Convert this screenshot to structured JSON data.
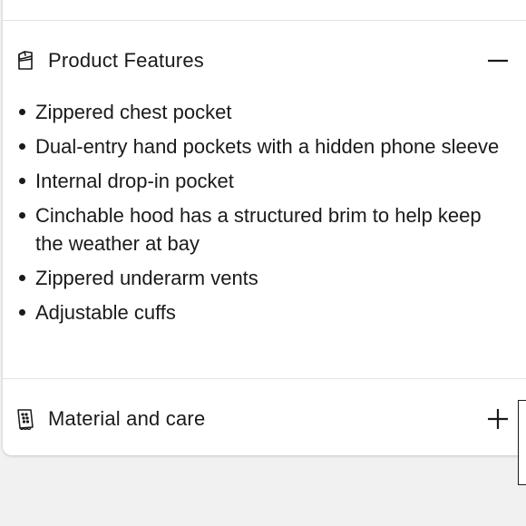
{
  "product_features": {
    "title": "Product Features",
    "icon": "jacket-icon",
    "toggle_icon": "minus-icon",
    "expanded": true,
    "items": [
      "Zippered chest pocket",
      "Dual-entry hand pockets with a hidden phone sleeve",
      "Internal drop-in pocket",
      "Cinchable hood has a structured brim to help keep the weather at bay",
      "Zippered underarm vents",
      "Adjustable cuffs"
    ]
  },
  "material_care": {
    "title": "Material and care",
    "icon": "care-label-icon",
    "toggle_icon": "plus-icon",
    "expanded": false
  },
  "colors": {
    "text": "#1a1a1a",
    "card": "#ffffff",
    "page": "#f1f1f1",
    "divider": "#e2e2e2"
  }
}
